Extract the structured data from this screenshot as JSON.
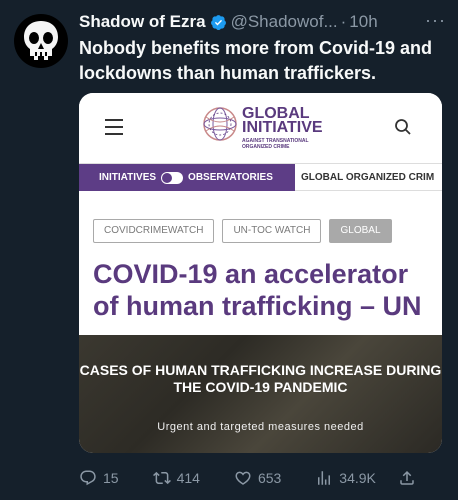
{
  "author": {
    "name": "Shadow of Ezra",
    "handle": "@Shadowof...",
    "separator": "·",
    "time": "10h",
    "more_label": "···"
  },
  "tweet": {
    "text": "Nobody benefits more from Covid-19 and lockdowns than human traffickers."
  },
  "card": {
    "logo": {
      "line1": "GLOBAL",
      "line2": "INITIATIVE",
      "sub1": "AGAINST TRANSNATIONAL",
      "sub2": "ORGANIZED CRIME"
    },
    "nav": {
      "initiatives": "INITIATIVES",
      "observatories": "OBSERVATORIES",
      "global_organized_crime": "GLOBAL ORGANIZED CRIM"
    },
    "tags": [
      "COVIDCRIMEWATCH",
      "UN-TOC WATCH",
      "GLOBAL"
    ],
    "headline": "COVID-19 an accelerator of human trafficking – UN",
    "hero": {
      "title": "CASES OF HUMAN TRAFFICKING INCREASE DURING THE COVID-19 PANDEMIC",
      "subtitle": "Urgent and targeted measures needed"
    }
  },
  "actions": {
    "replies": "15",
    "retweets": "414",
    "likes": "653",
    "views": "34.9K"
  },
  "colors": {
    "background": "#15202b",
    "verified": "#1d9bf0",
    "site_purple": "#5a3a7e",
    "muted": "#8b98a5"
  }
}
